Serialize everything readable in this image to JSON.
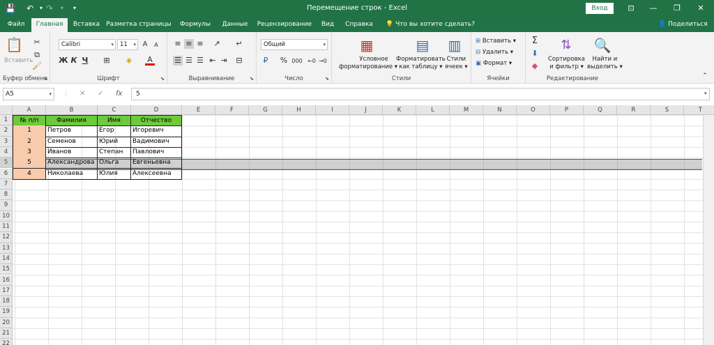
{
  "window": {
    "title": "Перемещение строк  -  Excel",
    "signin_label": "Вход",
    "minimize_glyph": "—",
    "restore_glyph": "❐",
    "close_glyph": "✕",
    "options_glyph": "⊡"
  },
  "quick_access": {
    "save_glyph": "💾",
    "undo_glyph": "↶",
    "redo_glyph": "↷",
    "customize_glyph": "▾"
  },
  "tabs": [
    "Файл",
    "Главная",
    "Вставка",
    "Разметка страницы",
    "Формулы",
    "Данные",
    "Рецензирование",
    "Вид",
    "Справка"
  ],
  "tell_me": "Что вы хотите сделать?",
  "share_label": "Поделиться",
  "ribbon": {
    "clipboard": {
      "paste_label": "Вставить",
      "group_label": "Буфер обмена"
    },
    "font": {
      "font_name": "Calibri",
      "font_size": "11",
      "bold": "Ж",
      "italic": "К",
      "underline": "Ч",
      "grow": "A",
      "shrink": "A",
      "font_color_glyph": "A",
      "group_label": "Шрифт"
    },
    "alignment": {
      "group_label": "Выравнивание"
    },
    "number": {
      "format": "Общий",
      "percent": "%",
      "thousands": "000",
      "group_label": "Число"
    },
    "styles": {
      "conditional": [
        "Условное",
        "форматирование ▾"
      ],
      "as_table": [
        "Форматировать",
        "как таблицу ▾"
      ],
      "cell_styles": [
        "Стили",
        "ячеек ▾"
      ],
      "group_label": "Стили"
    },
    "cells": {
      "insert": "Вставить",
      "delete": "Удалить",
      "format": "Формат",
      "group_label": "Ячейки"
    },
    "editing": {
      "sort": [
        "Сортировка",
        "и фильтр ▾"
      ],
      "find": [
        "Найти и",
        "выделить ▾"
      ],
      "group_label": "Редактирование"
    }
  },
  "formula_bar": {
    "name_box": "A5",
    "cancel_glyph": "✕",
    "enter_glyph": "✓",
    "fx": "fx",
    "value": "5"
  },
  "columns": [
    "A",
    "B",
    "C",
    "D",
    "E",
    "F",
    "G",
    "H",
    "I",
    "J",
    "K",
    "L",
    "M",
    "N",
    "O",
    "P",
    "Q",
    "R",
    "S",
    "T"
  ],
  "rows": [
    "1",
    "2",
    "3",
    "4",
    "5",
    "6",
    "7",
    "8",
    "9",
    "10",
    "11",
    "12",
    "13",
    "14",
    "15",
    "16",
    "17",
    "18",
    "19",
    "20",
    "21",
    "22"
  ],
  "table": {
    "headers": [
      "№ п/п",
      "Фамилия",
      "Имя",
      "Отчество"
    ],
    "rows": [
      [
        "1",
        "Петров",
        "Егор",
        "Игоревич"
      ],
      [
        "2",
        "Семенов",
        "Юрий",
        "Вадимович"
      ],
      [
        "3",
        "Иванов",
        "Степан",
        "Павлович"
      ],
      [
        "5",
        "Александрова",
        "Ольга",
        "Евгеньевна"
      ],
      [
        "4",
        "Николаева",
        "Юлия",
        "Алексеевна"
      ]
    ]
  },
  "colors": {
    "excel_green": "#217346",
    "header_fill": "#6ccb3a",
    "number_fill": "#f8cbad"
  }
}
